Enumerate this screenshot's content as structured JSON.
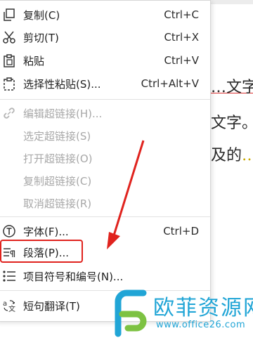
{
  "document": {
    "line1": "…文字",
    "line2": "文字。",
    "line3_a": "及的",
    "line3_b": "…"
  },
  "menu": {
    "items": [
      {
        "label": "复制(C)",
        "shortcut": "Ctrl+C",
        "icon": "copy-icon"
      },
      {
        "label": "剪切(T)",
        "shortcut": "Ctrl+X",
        "icon": "scissors-icon"
      },
      {
        "label": "粘贴",
        "shortcut": "Ctrl+V",
        "icon": "paste-icon"
      },
      {
        "label": "选择性粘贴(S)...",
        "shortcut": "Ctrl+Alt+V",
        "icon": "paste-special-icon"
      },
      {
        "label": "编辑超链接(H)...",
        "icon": "link-icon",
        "disabled": true
      },
      {
        "label": "选定超链接(S)",
        "disabled": true
      },
      {
        "label": "打开超链接(O)",
        "disabled": true
      },
      {
        "label": "复制超链接(C)",
        "disabled": true
      },
      {
        "label": "取消超链接(R)",
        "disabled": true
      },
      {
        "label": "字体(F)...",
        "shortcut": "Ctrl+D",
        "icon": "font-icon"
      },
      {
        "label": "段落(P)...",
        "icon": "paragraph-icon"
      },
      {
        "label": "项目符号和编号(N)...",
        "icon": "bullet-list-icon"
      },
      {
        "label": "短句翻译(T)",
        "icon": "translate-icon"
      }
    ]
  },
  "watermark": {
    "title": "欧菲资源网",
    "url": "www.office26.com"
  },
  "colors": {
    "highlight": "#e0231e",
    "watermark": "#21a5d6",
    "disabled_text": "#a8a8a8"
  }
}
